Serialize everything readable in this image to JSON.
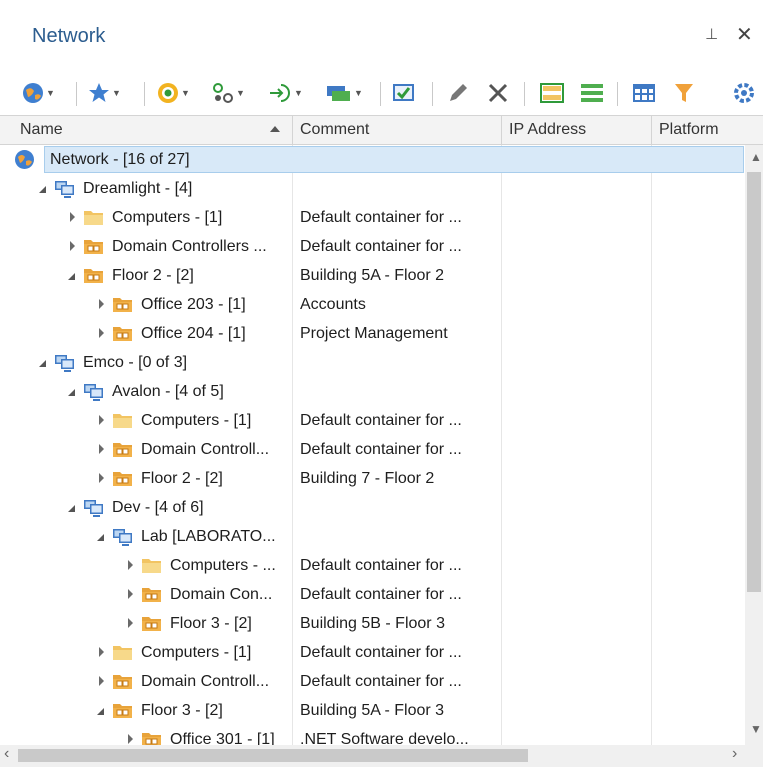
{
  "panel": {
    "title": "Network",
    "pin_glyph": "⊥",
    "close_glyph": "✕"
  },
  "toolbar": {
    "icons": [
      "globe-icon",
      "star-icon",
      "target-icon",
      "nodes-icon",
      "import-icon",
      "group-icon",
      "check-icon",
      "edit-icon",
      "delete-icon",
      "group-rows-icon",
      "lines-icon",
      "table-icon",
      "filter-icon",
      "settings-icon"
    ]
  },
  "columns": {
    "name": "Name",
    "comment": "Comment",
    "ip": "IP Address",
    "platform": "Platform"
  },
  "rows": [
    {
      "name": "Network - [16 of 27]",
      "comment": "",
      "icon": "globe",
      "level": 0,
      "state": "none",
      "selected": true
    },
    {
      "name": "Dreamlight - [4]",
      "comment": "",
      "icon": "computer",
      "level": 1,
      "state": "open"
    },
    {
      "name": "Computers - [1]",
      "comment": "Default container for ...",
      "icon": "folder",
      "level": 2,
      "state": "closed"
    },
    {
      "name": "Domain Controllers ...",
      "comment": "Default container for ...",
      "icon": "ou",
      "level": 2,
      "state": "closed"
    },
    {
      "name": "Floor 2 - [2]",
      "comment": "Building 5A - Floor 2",
      "icon": "ou",
      "level": 2,
      "state": "open"
    },
    {
      "name": "Office 203 - [1]",
      "comment": "Accounts",
      "icon": "ou",
      "level": 3,
      "state": "closed"
    },
    {
      "name": "Office 204 - [1]",
      "comment": "Project Management",
      "icon": "ou",
      "level": 3,
      "state": "closed"
    },
    {
      "name": "Emco - [0 of 3]",
      "comment": "",
      "icon": "computer",
      "level": 1,
      "state": "open"
    },
    {
      "name": "Avalon - [4 of 5]",
      "comment": "",
      "icon": "computer",
      "level": 2,
      "state": "open"
    },
    {
      "name": "Computers - [1]",
      "comment": "Default container for ...",
      "icon": "folder",
      "level": 3,
      "state": "closed"
    },
    {
      "name": "Domain Controll...",
      "comment": "Default container for ...",
      "icon": "ou",
      "level": 3,
      "state": "closed"
    },
    {
      "name": "Floor 2 - [2]",
      "comment": "Building 7 - Floor 2",
      "icon": "ou",
      "level": 3,
      "state": "closed"
    },
    {
      "name": "Dev - [4 of 6]",
      "comment": "",
      "icon": "computer",
      "level": 2,
      "state": "open"
    },
    {
      "name": "Lab [LABORATO...",
      "comment": "",
      "icon": "computer",
      "level": 3,
      "state": "open"
    },
    {
      "name": "Computers - ...",
      "comment": "Default container for ...",
      "icon": "folder",
      "level": 4,
      "state": "closed"
    },
    {
      "name": "Domain Con...",
      "comment": "Default container for ...",
      "icon": "ou",
      "level": 4,
      "state": "closed"
    },
    {
      "name": "Floor 3 - [2]",
      "comment": "Building 5B - Floor 3",
      "icon": "ou",
      "level": 4,
      "state": "closed"
    },
    {
      "name": "Computers - [1]",
      "comment": "Default container for ...",
      "icon": "folder",
      "level": 3,
      "state": "closed"
    },
    {
      "name": "Domain Controll...",
      "comment": "Default container for ...",
      "icon": "ou",
      "level": 3,
      "state": "closed"
    },
    {
      "name": "Floor 3 - [2]",
      "comment": "Building 5A - Floor 3",
      "icon": "ou",
      "level": 3,
      "state": "open"
    },
    {
      "name": "Office 301 - [1]",
      "comment": ".NET Software develo...",
      "icon": "ou",
      "level": 4,
      "state": "closed"
    }
  ],
  "colors": {
    "accent": "#2c5d8f",
    "selection": "#d8e9f8",
    "folder": "#f2c462",
    "ou": "#e8a33a",
    "computer": "#3f79c4"
  }
}
